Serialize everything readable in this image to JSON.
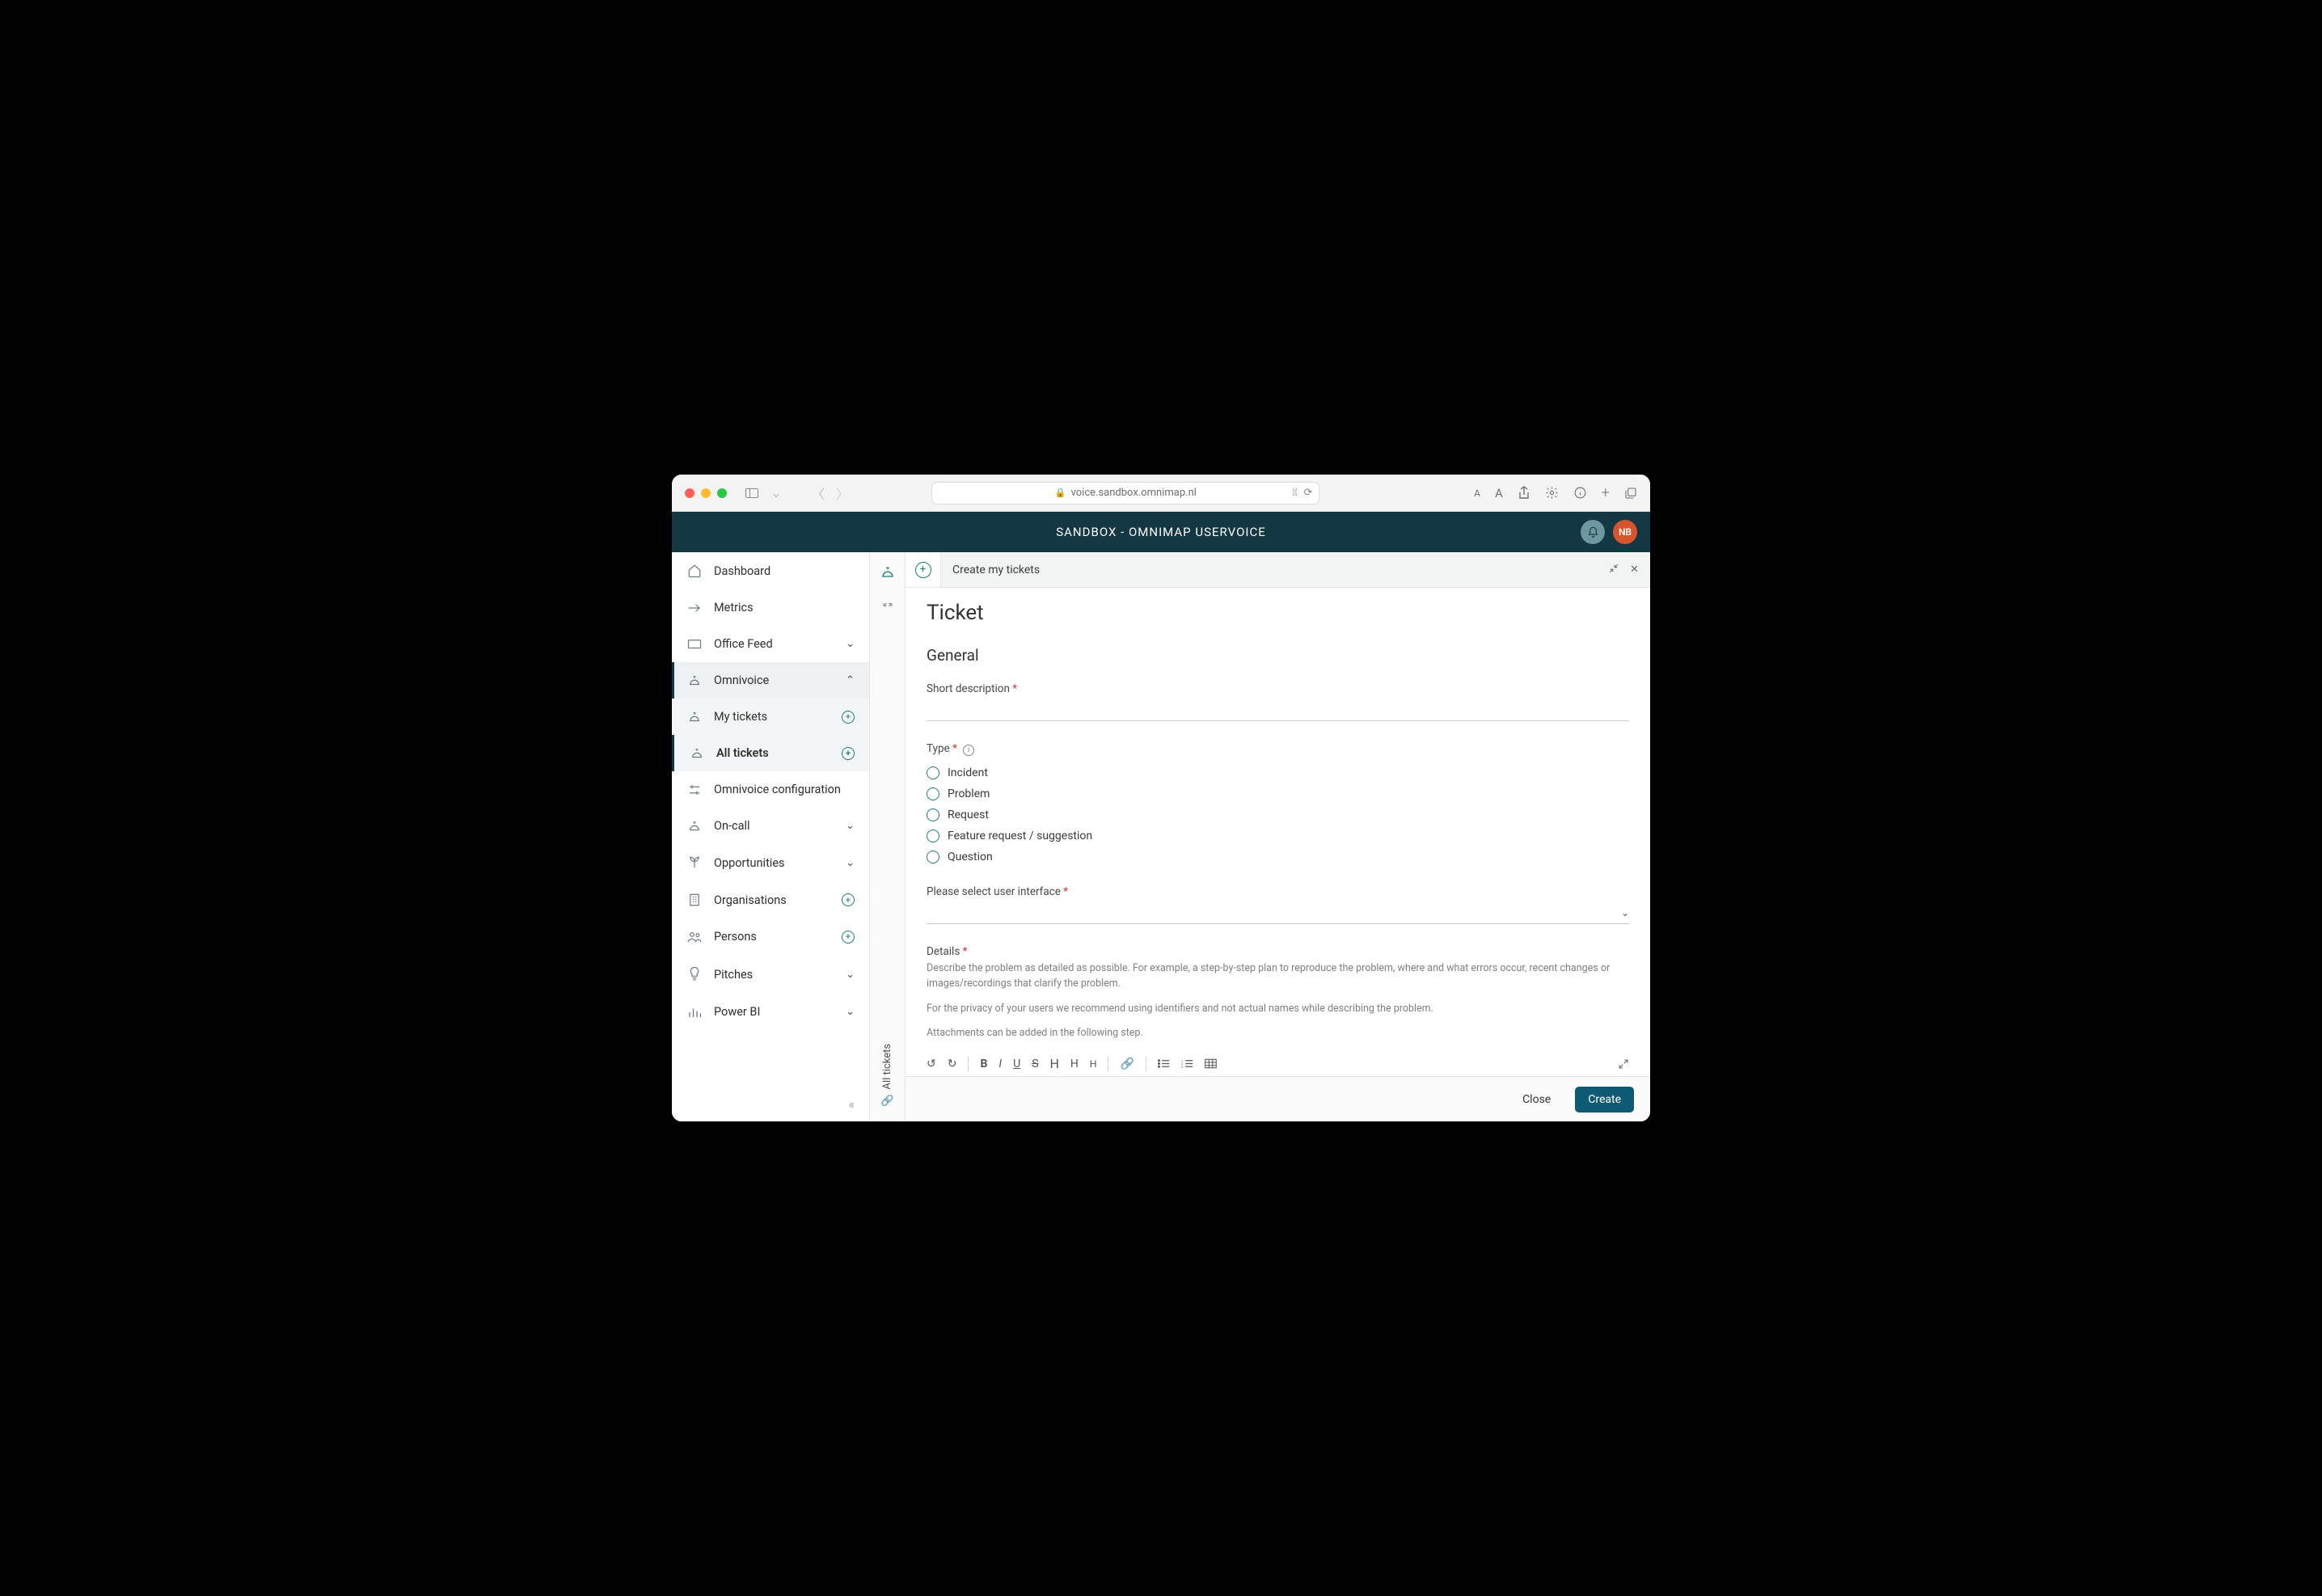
{
  "browser": {
    "url": "voice.sandbox.omnimap.nl"
  },
  "appbar": {
    "title": "SANDBOX - OMNIMAP USERVOICE",
    "avatar_initials": "NB"
  },
  "sidebar": {
    "items": [
      {
        "label": "Dashboard",
        "icon": "home"
      },
      {
        "label": "Metrics",
        "icon": "arrow-right"
      },
      {
        "label": "Office Feed",
        "icon": "monitor",
        "caret": "down"
      },
      {
        "label": "Omnivoice",
        "icon": "bell-service",
        "caret": "up",
        "expanded": true
      },
      {
        "label": "My tickets",
        "icon": "bell-service",
        "plus": true,
        "sub": true
      },
      {
        "label": "All tickets",
        "icon": "bell-service",
        "plus": true,
        "sub": true,
        "selected": true
      },
      {
        "label": "Omnivoice configuration",
        "icon": "sliders",
        "sub": true
      },
      {
        "label": "On-call",
        "icon": "bell-service",
        "caret": "down"
      },
      {
        "label": "Opportunities",
        "icon": "sprout",
        "caret": "down"
      },
      {
        "label": "Organisations",
        "icon": "building",
        "plus": true
      },
      {
        "label": "Persons",
        "icon": "people",
        "plus": true
      },
      {
        "label": "Pitches",
        "icon": "bulb",
        "caret": "down"
      },
      {
        "label": "Power BI",
        "icon": "chart",
        "caret": "down"
      }
    ]
  },
  "rail": {
    "vertical_label": "All tickets"
  },
  "tab": {
    "title": "Create my tickets"
  },
  "form": {
    "page_heading": "Ticket",
    "section_heading": "General",
    "short_desc_label": "Short description",
    "type_label": "Type",
    "type_options": [
      "Incident",
      "Problem",
      "Request",
      "Feature request / suggestion",
      "Question"
    ],
    "ui_label": "Please select user interface",
    "details_label": "Details",
    "details_help1": "Describe the problem as detailed as possible. For example, a step-by-step plan to reproduce the problem, where and what errors occur, recent changes or images/recordings that clarify the problem.",
    "details_help2": "For the privacy of your users we recommend using identifiers and not actual names while describing the problem.",
    "details_help3": "Attachments can be added in the following step."
  },
  "footer": {
    "close_label": "Close",
    "create_label": "Create"
  }
}
